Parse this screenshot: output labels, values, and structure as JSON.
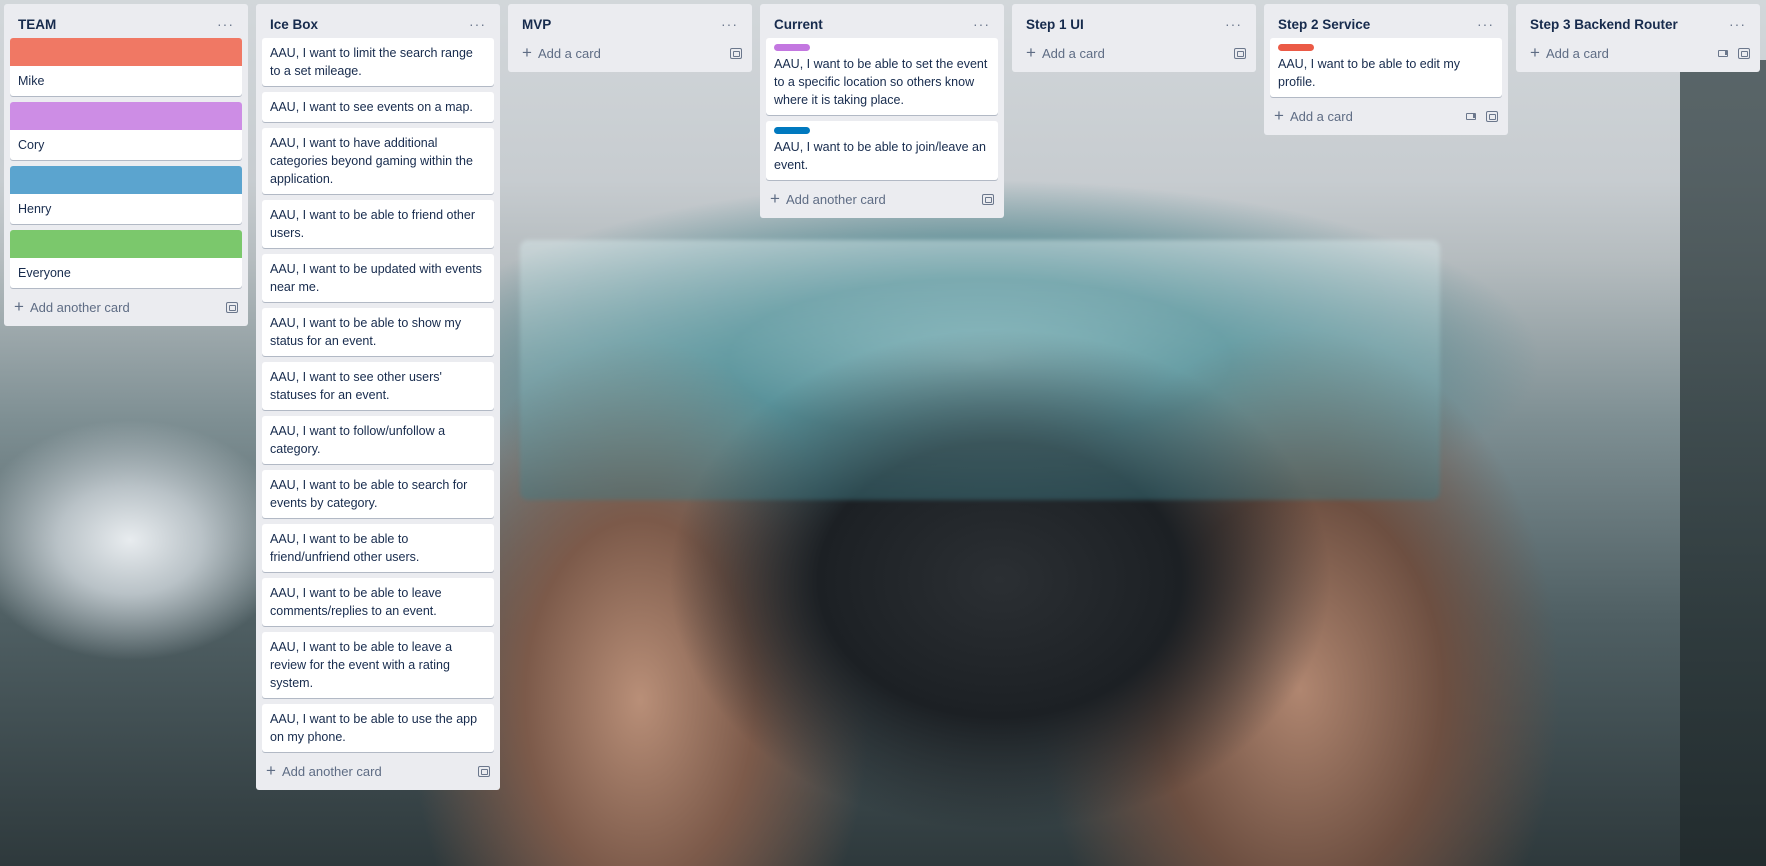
{
  "lists": {
    "team": {
      "title": "TEAM",
      "menu": "···",
      "members": [
        {
          "name": "Mike",
          "color": "#f07864"
        },
        {
          "name": "Cory",
          "color": "#cd8de5"
        },
        {
          "name": "Henry",
          "color": "#5ba4cf"
        },
        {
          "name": "Everyone",
          "color": "#7bc86c"
        }
      ],
      "add_label": "Add another card"
    },
    "icebox": {
      "title": "Ice Box",
      "menu": "···",
      "cards": [
        "AAU, I want to limit the search range to a set mileage.",
        "AAU, I want to see events on a map.",
        "AAU, I want to have additional categories beyond gaming within the application.",
        "AAU, I want to be able to friend other users.",
        "AAU, I want to be updated with events near me.",
        "AAU, I want to be able to show my status for an event.",
        "AAU, I want to see other users' statuses for an event.",
        "AAU, I want to follow/unfollow a category.",
        "AAU, I want to be able to search for events by category.",
        "AAU, I want to be able to friend/unfriend other users.",
        "AAU, I want to be able to leave comments/replies to an event.",
        "AAU, I want to be able to leave a review for the event with a rating system.",
        "AAU, I want to be able to use the app on my phone."
      ],
      "add_label": "Add another card"
    },
    "mvp": {
      "title": "MVP",
      "menu": "···",
      "add_label": "Add a card"
    },
    "current": {
      "title": "Current",
      "menu": "···",
      "cards": [
        {
          "text": "AAU, I want to be able to set the event to a specific location so others know where it is taking place.",
          "label_color": "#c377e0"
        },
        {
          "text": "AAU, I want to be able to join/leave an event.",
          "label_color": "#0079bf"
        }
      ],
      "add_label": "Add another card"
    },
    "step1": {
      "title": "Step 1 UI",
      "menu": "···",
      "add_label": "Add a card"
    },
    "step2": {
      "title": "Step 2 Service",
      "menu": "···",
      "cards": [
        {
          "text": "AAU, I want to be able to edit my profile.",
          "label_color": "#eb5a46"
        }
      ],
      "add_label": "Add a card"
    },
    "step3": {
      "title": "Step 3 Backend Router",
      "menu": "···",
      "add_label": "Add a card"
    }
  }
}
